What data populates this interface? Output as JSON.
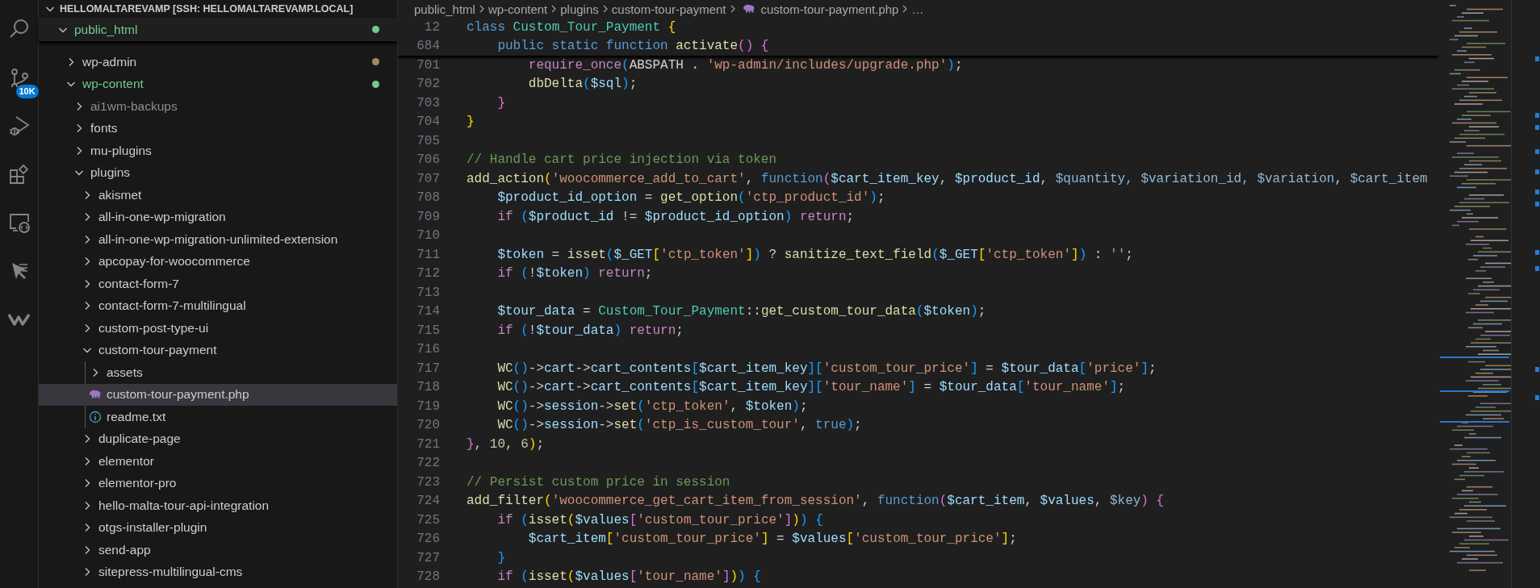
{
  "activity_bar": {
    "items": [
      {
        "kind": "search"
      },
      {
        "kind": "source-control",
        "badge": "10K"
      },
      {
        "kind": "run-debug"
      },
      {
        "kind": "extensions"
      },
      {
        "kind": "remote-explorer"
      },
      {
        "kind": "cursor"
      },
      {
        "kind": "w-logo"
      }
    ]
  },
  "explorer": {
    "root": {
      "label": "HELLOMALTAREVAMP [SSH: HELLOMALTAREVAMP.LOCAL]",
      "expanded": true
    },
    "items": [
      {
        "label": "public_html",
        "kind": "folder",
        "expanded": true,
        "selected": false,
        "color": "#73c991",
        "colored_label": true,
        "dot": true,
        "children": [
          {
            "label": "wp-admin",
            "kind": "folder",
            "expanded": false,
            "selected": false,
            "color": "#a08a5e",
            "colored_label": false,
            "dot": true
          },
          {
            "label": "wp-content",
            "kind": "folder",
            "expanded": true,
            "selected": false,
            "color": "#73c991",
            "colored_label": true,
            "dot": true,
            "children": [
              {
                "label": "ai1wm-backups",
                "kind": "folder",
                "expanded": false,
                "selected": false,
                "color": "#8c8c8c",
                "colored_label": true,
                "dot": false
              },
              {
                "label": "fonts",
                "kind": "folder",
                "expanded": false,
                "selected": false
              },
              {
                "label": "mu-plugins",
                "kind": "folder",
                "expanded": false,
                "selected": false
              },
              {
                "label": "plugins",
                "kind": "folder",
                "expanded": true,
                "selected": false,
                "children": [
                  {
                    "label": "akismet",
                    "kind": "folder",
                    "expanded": false,
                    "selected": false
                  },
                  {
                    "label": "all-in-one-wp-migration",
                    "kind": "folder",
                    "expanded": false,
                    "selected": false
                  },
                  {
                    "label": "all-in-one-wp-migration-unlimited-extension",
                    "kind": "folder",
                    "expanded": false,
                    "selected": false
                  },
                  {
                    "label": "apcopay-for-woocommerce",
                    "kind": "folder",
                    "expanded": false,
                    "selected": false
                  },
                  {
                    "label": "contact-form-7",
                    "kind": "folder",
                    "expanded": false,
                    "selected": false
                  },
                  {
                    "label": "contact-form-7-multilingual",
                    "kind": "folder",
                    "expanded": false,
                    "selected": false
                  },
                  {
                    "label": "custom-post-type-ui",
                    "kind": "folder",
                    "expanded": false,
                    "selected": false
                  },
                  {
                    "label": "custom-tour-payment",
                    "kind": "folder",
                    "expanded": true,
                    "selected": false,
                    "children": [
                      {
                        "label": "assets",
                        "kind": "folder",
                        "expanded": false,
                        "selected": false
                      },
                      {
                        "label": "custom-tour-payment.php",
                        "kind": "php-file",
                        "selected": true
                      },
                      {
                        "label": "readme.txt",
                        "kind": "text-file",
                        "selected": false
                      }
                    ]
                  },
                  {
                    "label": "duplicate-page",
                    "kind": "folder",
                    "expanded": false,
                    "selected": false
                  },
                  {
                    "label": "elementor",
                    "kind": "folder",
                    "expanded": false,
                    "selected": false
                  },
                  {
                    "label": "elementor-pro",
                    "kind": "folder",
                    "expanded": false,
                    "selected": false
                  },
                  {
                    "label": "hello-malta-tour-api-integration",
                    "kind": "folder",
                    "expanded": false,
                    "selected": false
                  },
                  {
                    "label": "otgs-installer-plugin",
                    "kind": "folder",
                    "expanded": false,
                    "selected": false
                  },
                  {
                    "label": "send-app",
                    "kind": "folder",
                    "expanded": false,
                    "selected": false
                  },
                  {
                    "label": "sitepress-multilingual-cms",
                    "kind": "folder",
                    "expanded": false,
                    "selected": false
                  }
                ]
              }
            ]
          }
        ]
      }
    ]
  },
  "editor": {
    "breadcrumbs": [
      {
        "label": "public_html",
        "kind": "folder"
      },
      {
        "label": "wp-content",
        "kind": "folder"
      },
      {
        "label": "plugins",
        "kind": "folder"
      },
      {
        "label": "custom-tour-payment",
        "kind": "folder"
      },
      {
        "label": "custom-tour-payment.php",
        "kind": "php-file"
      },
      {
        "label": "…",
        "kind": "more"
      }
    ],
    "sticky_lines": [
      {
        "number": "12",
        "tokens": [
          {
            "text": "class",
            "color": "#569cd6"
          },
          {
            "text": " Custom_Tour_Payment",
            "color": "#4ec9b0"
          },
          {
            "text": " {",
            "color": "#ffd700"
          }
        ]
      },
      {
        "number": "684",
        "tokens": [
          {
            "text": "    public static function",
            "color": "#569cd6"
          },
          {
            "text": " activate",
            "color": "#dcdcaa"
          },
          {
            "text": "()",
            "color": "#da70d6"
          },
          {
            "text": " {",
            "color": "#da70d6"
          }
        ]
      }
    ],
    "lines": [
      {
        "number": "701",
        "tokens": [
          {
            "text": "        require_once",
            "color": "#c586c0"
          },
          {
            "text": "(",
            "color": "#179fff"
          },
          {
            "text": "ABSPATH . ",
            "color": "#d4d4d4"
          },
          {
            "text": "'wp-admin/includes/upgrade.php'",
            "color": "#ce9178"
          },
          {
            "text": ")",
            "color": "#179fff"
          },
          {
            "text": ";",
            "color": "#cccccc"
          }
        ]
      },
      {
        "number": "702",
        "tokens": [
          {
            "text": "        dbDelta",
            "color": "#dcdcaa"
          },
          {
            "text": "(",
            "color": "#179fff"
          },
          {
            "text": "$sql",
            "color": "#9cdcfe"
          },
          {
            "text": ")",
            "color": "#179fff"
          },
          {
            "text": ";",
            "color": "#cccccc"
          }
        ]
      },
      {
        "number": "703",
        "tokens": [
          {
            "text": "    }",
            "color": "#da70d6"
          }
        ]
      },
      {
        "number": "704",
        "tokens": [
          {
            "text": "}",
            "color": "#ffd700"
          }
        ]
      },
      {
        "number": "705"
      },
      {
        "number": "706",
        "tokens": [
          {
            "text": "// Handle cart price injection via token",
            "color": "#6a9955"
          }
        ]
      },
      {
        "number": "707",
        "tokens": [
          {
            "text": "add_action",
            "color": "#dcdcaa"
          },
          {
            "text": "(",
            "color": "#ffd700"
          },
          {
            "text": "'woocommerce_add_to_cart'",
            "color": "#ce9178"
          },
          {
            "text": ", ",
            "color": "#cccccc"
          },
          {
            "text": "function",
            "color": "#569cd6"
          },
          {
            "text": "(",
            "color": "#da70d6"
          },
          {
            "text": "$cart_item_key",
            "color": "#9cdcfe"
          },
          {
            "text": ", ",
            "color": "#cccccc"
          },
          {
            "text": "$product_id",
            "color": "#9cdcfe"
          },
          {
            "text": ", ",
            "color": "#cccccc"
          },
          {
            "text": "$quantity, ",
            "color": "#8fb8d8"
          },
          {
            "text": "$variation_id, ",
            "color": "#8fb8d8"
          },
          {
            "text": "$variation",
            "color": "#8fb8d8"
          },
          {
            "text": ", ",
            "color": "#cccccc"
          },
          {
            "text": "$cart_item",
            "color": "#8fb8d8"
          }
        ]
      },
      {
        "number": "708",
        "tokens": [
          {
            "text": "    $product_id_option",
            "color": "#9cdcfe"
          },
          {
            "text": " = ",
            "color": "#cccccc"
          },
          {
            "text": "get_option",
            "color": "#dcdcaa"
          },
          {
            "text": "(",
            "color": "#179fff"
          },
          {
            "text": "'ctp_product_id'",
            "color": "#ce9178"
          },
          {
            "text": ")",
            "color": "#179fff"
          },
          {
            "text": ";",
            "color": "#cccccc"
          }
        ]
      },
      {
        "number": "709",
        "tokens": [
          {
            "text": "    if",
            "color": "#c586c0"
          },
          {
            "text": " (",
            "color": "#179fff"
          },
          {
            "text": "$product_id",
            "color": "#9cdcfe"
          },
          {
            "text": " != ",
            "color": "#cccccc"
          },
          {
            "text": "$product_id_option",
            "color": "#9cdcfe"
          },
          {
            "text": ")",
            "color": "#179fff"
          },
          {
            "text": " return",
            "color": "#c586c0"
          },
          {
            "text": ";",
            "color": "#cccccc"
          }
        ]
      },
      {
        "number": "710"
      },
      {
        "number": "711",
        "tokens": [
          {
            "text": "    $token",
            "color": "#9cdcfe"
          },
          {
            "text": " = ",
            "color": "#cccccc"
          },
          {
            "text": "isset",
            "color": "#dcdcaa"
          },
          {
            "text": "(",
            "color": "#179fff"
          },
          {
            "text": "$_GET",
            "color": "#9cdcfe"
          },
          {
            "text": "[",
            "color": "#ffd700"
          },
          {
            "text": "'ctp_token'",
            "color": "#ce9178"
          },
          {
            "text": "]",
            "color": "#ffd700"
          },
          {
            "text": ")",
            "color": "#179fff"
          },
          {
            "text": " ? ",
            "color": "#cccccc"
          },
          {
            "text": "sanitize_text_field",
            "color": "#dcdcaa"
          },
          {
            "text": "(",
            "color": "#179fff"
          },
          {
            "text": "$_GET",
            "color": "#9cdcfe"
          },
          {
            "text": "[",
            "color": "#ffd700"
          },
          {
            "text": "'ctp_token'",
            "color": "#ce9178"
          },
          {
            "text": "]",
            "color": "#ffd700"
          },
          {
            "text": ")",
            "color": "#179fff"
          },
          {
            "text": " : ",
            "color": "#cccccc"
          },
          {
            "text": "''",
            "color": "#ce9178"
          },
          {
            "text": ";",
            "color": "#cccccc"
          }
        ]
      },
      {
        "number": "712",
        "tokens": [
          {
            "text": "    if",
            "color": "#c586c0"
          },
          {
            "text": " (",
            "color": "#179fff"
          },
          {
            "text": "!",
            "color": "#cccccc"
          },
          {
            "text": "$token",
            "color": "#9cdcfe"
          },
          {
            "text": ")",
            "color": "#179fff"
          },
          {
            "text": " return",
            "color": "#c586c0"
          },
          {
            "text": ";",
            "color": "#cccccc"
          }
        ]
      },
      {
        "number": "713"
      },
      {
        "number": "714",
        "tokens": [
          {
            "text": "    $tour_data",
            "color": "#9cdcfe"
          },
          {
            "text": " = ",
            "color": "#cccccc"
          },
          {
            "text": "Custom_Tour_Payment",
            "color": "#4ec9b0"
          },
          {
            "text": "::",
            "color": "#cccccc"
          },
          {
            "text": "get_custom_tour_data",
            "color": "#dcdcaa"
          },
          {
            "text": "(",
            "color": "#179fff"
          },
          {
            "text": "$token",
            "color": "#9cdcfe"
          },
          {
            "text": ")",
            "color": "#179fff"
          },
          {
            "text": ";",
            "color": "#cccccc"
          }
        ]
      },
      {
        "number": "715",
        "tokens": [
          {
            "text": "    if",
            "color": "#c586c0"
          },
          {
            "text": " (",
            "color": "#179fff"
          },
          {
            "text": "!",
            "color": "#cccccc"
          },
          {
            "text": "$tour_data",
            "color": "#9cdcfe"
          },
          {
            "text": ")",
            "color": "#179fff"
          },
          {
            "text": " return",
            "color": "#c586c0"
          },
          {
            "text": ";",
            "color": "#cccccc"
          }
        ]
      },
      {
        "number": "716"
      },
      {
        "number": "717",
        "tokens": [
          {
            "text": "    WC",
            "color": "#dcdcaa"
          },
          {
            "text": "()",
            "color": "#179fff"
          },
          {
            "text": "->",
            "color": "#cccccc"
          },
          {
            "text": "cart",
            "color": "#9cdcfe"
          },
          {
            "text": "->",
            "color": "#cccccc"
          },
          {
            "text": "cart_contents",
            "color": "#9cdcfe"
          },
          {
            "text": "[",
            "color": "#179fff"
          },
          {
            "text": "$cart_item_key",
            "color": "#9cdcfe"
          },
          {
            "text": "][",
            "color": "#179fff"
          },
          {
            "text": "'custom_tour_price'",
            "color": "#ce9178"
          },
          {
            "text": "]",
            "color": "#179fff"
          },
          {
            "text": " = ",
            "color": "#cccccc"
          },
          {
            "text": "$tour_data",
            "color": "#9cdcfe"
          },
          {
            "text": "[",
            "color": "#179fff"
          },
          {
            "text": "'price'",
            "color": "#ce9178"
          },
          {
            "text": "]",
            "color": "#179fff"
          },
          {
            "text": ";",
            "color": "#cccccc"
          }
        ]
      },
      {
        "number": "718",
        "tokens": [
          {
            "text": "    WC",
            "color": "#dcdcaa"
          },
          {
            "text": "()",
            "color": "#179fff"
          },
          {
            "text": "->",
            "color": "#cccccc"
          },
          {
            "text": "cart",
            "color": "#9cdcfe"
          },
          {
            "text": "->",
            "color": "#cccccc"
          },
          {
            "text": "cart_contents",
            "color": "#9cdcfe"
          },
          {
            "text": "[",
            "color": "#179fff"
          },
          {
            "text": "$cart_item_key",
            "color": "#9cdcfe"
          },
          {
            "text": "][",
            "color": "#179fff"
          },
          {
            "text": "'tour_name'",
            "color": "#ce9178"
          },
          {
            "text": "]",
            "color": "#179fff"
          },
          {
            "text": " = ",
            "color": "#cccccc"
          },
          {
            "text": "$tour_data",
            "color": "#9cdcfe"
          },
          {
            "text": "[",
            "color": "#179fff"
          },
          {
            "text": "'tour_name'",
            "color": "#ce9178"
          },
          {
            "text": "]",
            "color": "#179fff"
          },
          {
            "text": ";",
            "color": "#cccccc"
          }
        ]
      },
      {
        "number": "719",
        "tokens": [
          {
            "text": "    WC",
            "color": "#dcdcaa"
          },
          {
            "text": "()",
            "color": "#179fff"
          },
          {
            "text": "->",
            "color": "#cccccc"
          },
          {
            "text": "session",
            "color": "#9cdcfe"
          },
          {
            "text": "->",
            "color": "#cccccc"
          },
          {
            "text": "set",
            "color": "#dcdcaa"
          },
          {
            "text": "(",
            "color": "#179fff"
          },
          {
            "text": "'ctp_token'",
            "color": "#ce9178"
          },
          {
            "text": ", ",
            "color": "#cccccc"
          },
          {
            "text": "$token",
            "color": "#9cdcfe"
          },
          {
            "text": ")",
            "color": "#179fff"
          },
          {
            "text": ";",
            "color": "#cccccc"
          }
        ]
      },
      {
        "number": "720",
        "tokens": [
          {
            "text": "    WC",
            "color": "#dcdcaa"
          },
          {
            "text": "()",
            "color": "#179fff"
          },
          {
            "text": "->",
            "color": "#cccccc"
          },
          {
            "text": "session",
            "color": "#9cdcfe"
          },
          {
            "text": "->",
            "color": "#cccccc"
          },
          {
            "text": "set",
            "color": "#dcdcaa"
          },
          {
            "text": "(",
            "color": "#179fff"
          },
          {
            "text": "'ctp_is_custom_tour'",
            "color": "#ce9178"
          },
          {
            "text": ", ",
            "color": "#cccccc"
          },
          {
            "text": "true",
            "color": "#569cd6"
          },
          {
            "text": ")",
            "color": "#179fff"
          },
          {
            "text": ";",
            "color": "#cccccc"
          }
        ]
      },
      {
        "number": "721",
        "tokens": [
          {
            "text": "}",
            "color": "#da70d6"
          },
          {
            "text": ", ",
            "color": "#cccccc"
          },
          {
            "text": "10",
            "color": "#b5cea8"
          },
          {
            "text": ", ",
            "color": "#cccccc"
          },
          {
            "text": "6",
            "color": "#b5cea8"
          },
          {
            "text": ")",
            "color": "#ffd700"
          },
          {
            "text": ";",
            "color": "#cccccc"
          }
        ]
      },
      {
        "number": "722"
      },
      {
        "number": "723",
        "tokens": [
          {
            "text": "// Persist custom price in session",
            "color": "#6a9955"
          }
        ]
      },
      {
        "number": "724",
        "tokens": [
          {
            "text": "add_filter",
            "color": "#dcdcaa"
          },
          {
            "text": "(",
            "color": "#ffd700"
          },
          {
            "text": "'woocommerce_get_cart_item_from_session'",
            "color": "#ce9178"
          },
          {
            "text": ", ",
            "color": "#cccccc"
          },
          {
            "text": "function",
            "color": "#569cd6"
          },
          {
            "text": "(",
            "color": "#da70d6"
          },
          {
            "text": "$cart_item, ",
            "color": "#9cdcfe"
          },
          {
            "text": "$values",
            "color": "#9cdcfe"
          },
          {
            "text": ", ",
            "color": "#cccccc"
          },
          {
            "text": "$key",
            "color": "#8fb8d8"
          },
          {
            "text": ")",
            "color": "#da70d6"
          },
          {
            "text": " {",
            "color": "#da70d6"
          }
        ]
      },
      {
        "number": "725",
        "tokens": [
          {
            "text": "    if",
            "color": "#c586c0"
          },
          {
            "text": " (",
            "color": "#179fff"
          },
          {
            "text": "isset",
            "color": "#dcdcaa"
          },
          {
            "text": "(",
            "color": "#ffd700"
          },
          {
            "text": "$values",
            "color": "#9cdcfe"
          },
          {
            "text": "[",
            "color": "#da70d6"
          },
          {
            "text": "'custom_tour_price'",
            "color": "#ce9178"
          },
          {
            "text": "]",
            "color": "#da70d6"
          },
          {
            "text": ")",
            "color": "#ffd700"
          },
          {
            "text": ")",
            "color": "#179fff"
          },
          {
            "text": " {",
            "color": "#179fff"
          }
        ]
      },
      {
        "number": "726",
        "tokens": [
          {
            "text": "        $cart_item",
            "color": "#9cdcfe"
          },
          {
            "text": "[",
            "color": "#ffd700"
          },
          {
            "text": "'custom_tour_price'",
            "color": "#ce9178"
          },
          {
            "text": "]",
            "color": "#ffd700"
          },
          {
            "text": " = ",
            "color": "#cccccc"
          },
          {
            "text": "$values",
            "color": "#9cdcfe"
          },
          {
            "text": "[",
            "color": "#ffd700"
          },
          {
            "text": "'custom_tour_price'",
            "color": "#ce9178"
          },
          {
            "text": "]",
            "color": "#ffd700"
          },
          {
            "text": ";",
            "color": "#cccccc"
          }
        ]
      },
      {
        "number": "727",
        "tokens": [
          {
            "text": "    }",
            "color": "#179fff"
          }
        ]
      },
      {
        "number": "728",
        "tokens": [
          {
            "text": "    if",
            "color": "#c586c0"
          },
          {
            "text": " (",
            "color": "#179fff"
          },
          {
            "text": "isset",
            "color": "#dcdcaa"
          },
          {
            "text": "(",
            "color": "#ffd700"
          },
          {
            "text": "$values",
            "color": "#9cdcfe"
          },
          {
            "text": "[",
            "color": "#da70d6"
          },
          {
            "text": "'tour_name'",
            "color": "#ce9178"
          },
          {
            "text": "]",
            "color": "#da70d6"
          },
          {
            "text": ")",
            "color": "#ffd700"
          },
          {
            "text": ")",
            "color": "#179fff"
          },
          {
            "text": " {",
            "color": "#179fff"
          }
        ]
      }
    ]
  }
}
